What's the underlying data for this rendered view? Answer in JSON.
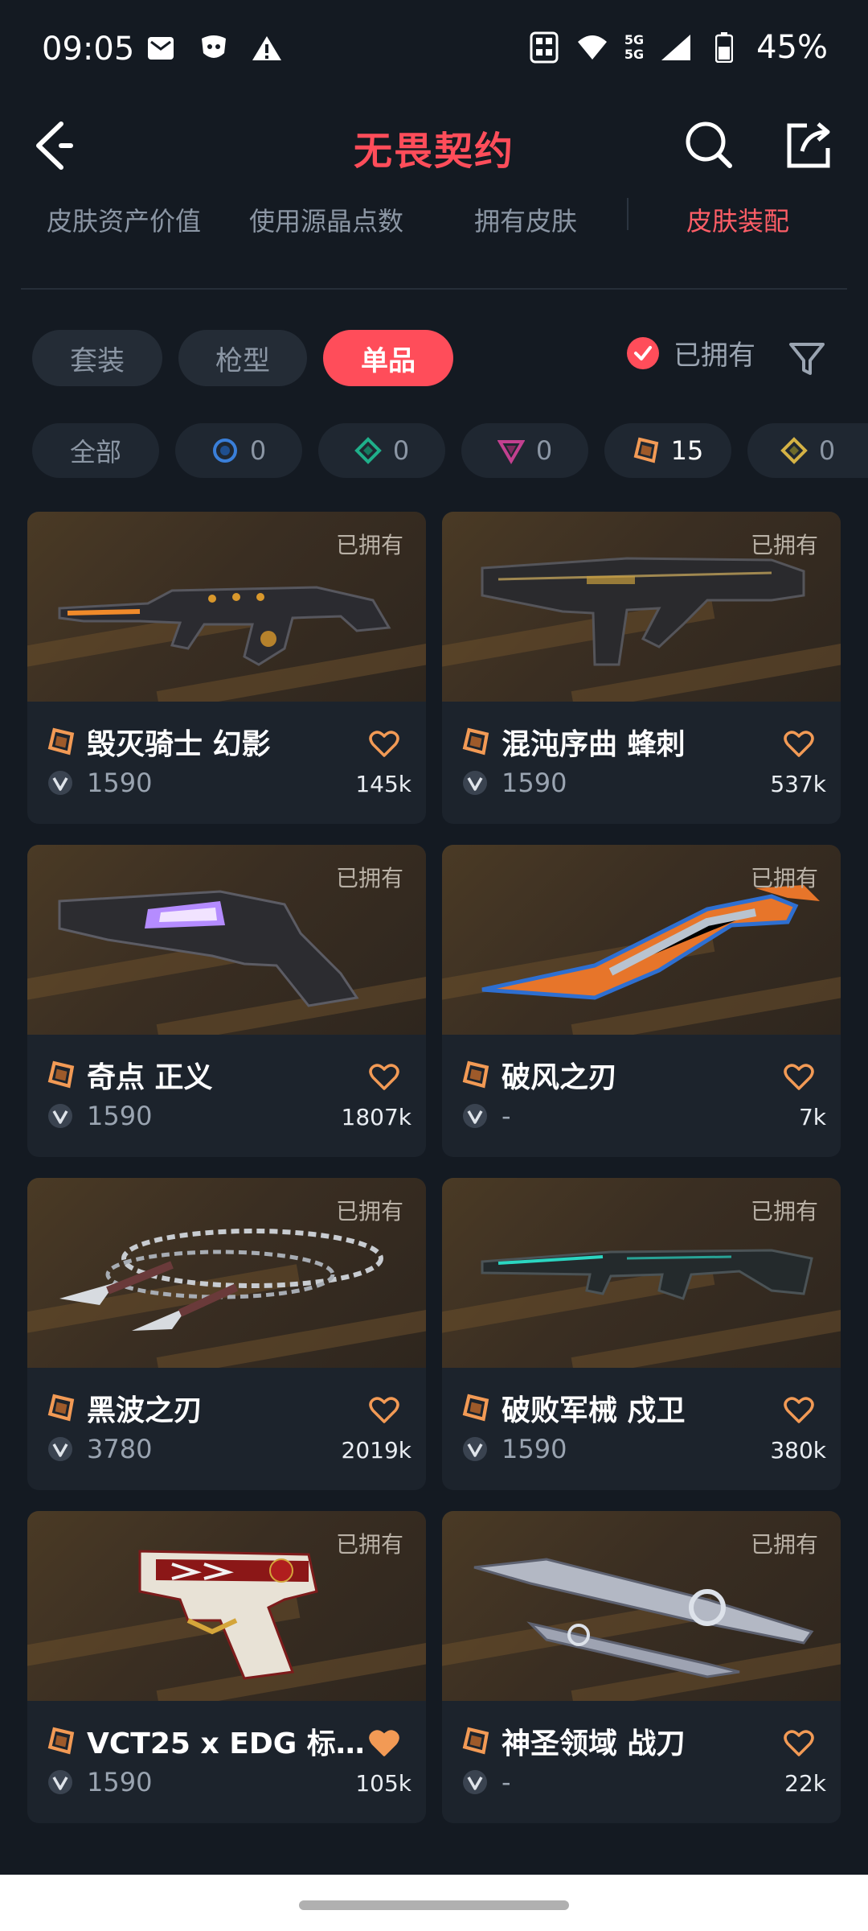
{
  "status": {
    "time": "09:05",
    "network_top": "5G",
    "network_bottom": "5G",
    "battery": "45%"
  },
  "header": {
    "title": "无畏契约"
  },
  "tabs": [
    "皮肤资产价值",
    "使用源晶点数",
    "拥有皮肤",
    "皮肤装配"
  ],
  "active_tab": "皮肤装配",
  "filters": {
    "types": [
      "套装",
      "枪型",
      "单品"
    ],
    "active_type": "单品",
    "owned_label": "已拥有",
    "owned_checked": true
  },
  "tiers": [
    {
      "label": "全部"
    },
    {
      "icon": "select-tier-icon",
      "count": "0",
      "color": "#3a7fd9"
    },
    {
      "icon": "deluxe-tier-icon",
      "count": "0",
      "color": "#1faf8a"
    },
    {
      "icon": "premium-tier-icon",
      "count": "0",
      "color": "#c2408f"
    },
    {
      "icon": "exclusive-tier-icon",
      "count": "15",
      "color": "#f29a55"
    },
    {
      "icon": "ultra-tier-icon",
      "count": "0",
      "color": "#d4b245"
    }
  ],
  "cards": [
    {
      "name": "毁灭骑士 幻影",
      "price": "1590",
      "likes": "145k",
      "owned": "已拥有",
      "weapon": "rifle-dark",
      "liked": false
    },
    {
      "name": "混沌序曲 蜂刺",
      "price": "1590",
      "likes": "537k",
      "owned": "已拥有",
      "weapon": "smg-dark",
      "liked": false
    },
    {
      "name": "奇点 正义",
      "price": "1590",
      "likes": "1807k",
      "owned": "已拥有",
      "weapon": "revolver",
      "liked": false
    },
    {
      "name": "破风之刃",
      "price": "-",
      "likes": "7k",
      "owned": "已拥有",
      "weapon": "blade-orange",
      "liked": false
    },
    {
      "name": "黑波之刃",
      "price": "3780",
      "likes": "2019k",
      "owned": "已拥有",
      "weapon": "kunai-chain",
      "liked": false
    },
    {
      "name": "破败军械 戍卫",
      "price": "1590",
      "likes": "380k",
      "owned": "已拥有",
      "weapon": "rifle-teal",
      "liked": false
    },
    {
      "name": "VCT25 x EDG 标...",
      "price": "1590",
      "likes": "105k",
      "owned": "已拥有",
      "weapon": "pistol-edg",
      "liked": true
    },
    {
      "name": "神圣领域 战刀",
      "price": "-",
      "likes": "22k",
      "owned": "已拥有",
      "weapon": "knife-silver",
      "liked": false
    }
  ],
  "colors": {
    "accent": "#ff4d5a",
    "background": "#141a22",
    "card": "#1c232c",
    "heart": "#f29a55"
  }
}
